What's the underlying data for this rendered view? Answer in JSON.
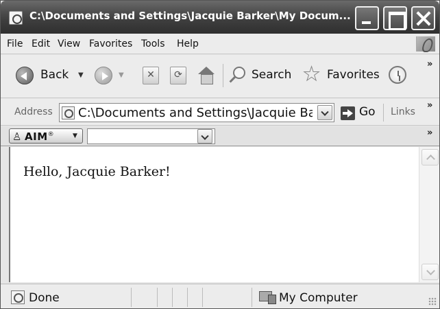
{
  "window": {
    "title": "C:\\Documents and Settings\\Jacquie Barker\\My Docum..."
  },
  "menu": {
    "items": [
      "File",
      "Edit",
      "View",
      "Favorites",
      "Tools",
      "Help"
    ]
  },
  "toolbar": {
    "back_label": "Back",
    "search_label": "Search",
    "favorites_label": "Favorites"
  },
  "address": {
    "label": "Address",
    "value": "C:\\Documents and Settings\\Jacquie Barker\\My Documents",
    "go_label": "Go",
    "links_label": "Links"
  },
  "aim": {
    "label": "AIM",
    "reg": "®",
    "input_value": ""
  },
  "content": {
    "greeting": "Hello, Jacquie Barker!"
  },
  "status": {
    "text": "Done",
    "zone": "My Computer"
  }
}
